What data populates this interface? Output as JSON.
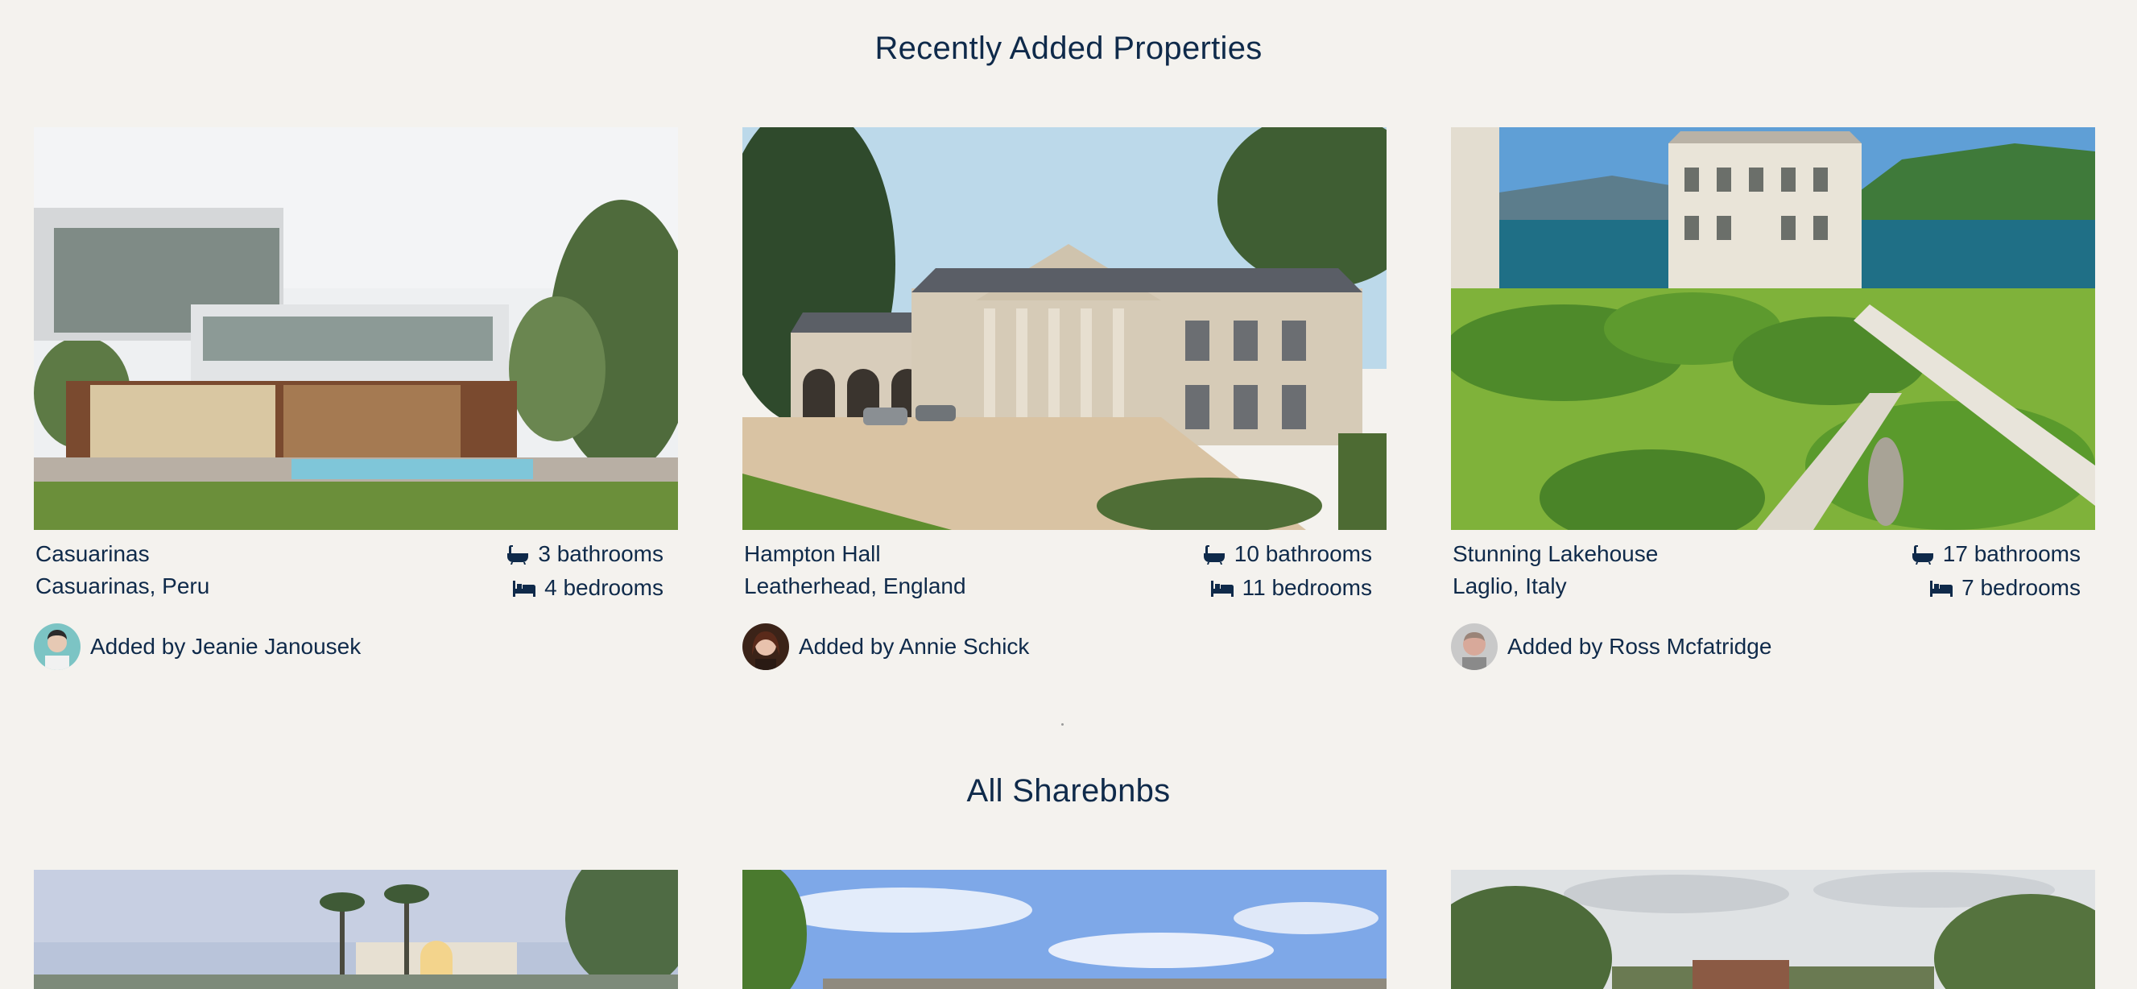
{
  "sections": {
    "recent_title": "Recently Added Properties",
    "all_title": "All Sharebnbs"
  },
  "recent": [
    {
      "name": "Casuarinas",
      "location": "Casuarinas, Peru",
      "bathrooms": "3 bathrooms",
      "bedrooms": "4 bedrooms",
      "added_by": "Added by Jeanie Janousek"
    },
    {
      "name": "Hampton Hall",
      "location": "Leatherhead, England",
      "bathrooms": "10 bathrooms",
      "bedrooms": "11 bedrooms",
      "added_by": "Added by Annie Schick"
    },
    {
      "name": "Stunning Lakehouse",
      "location": "Laglio, Italy",
      "bathrooms": "17 bathrooms",
      "bedrooms": "7 bedrooms",
      "added_by": "Added by Ross Mcfatridge"
    }
  ],
  "icons": {
    "bath": "bathtub-icon",
    "bed": "bed-icon"
  },
  "colors": {
    "background": "#f4f2ee",
    "text": "#0f2a4a"
  }
}
